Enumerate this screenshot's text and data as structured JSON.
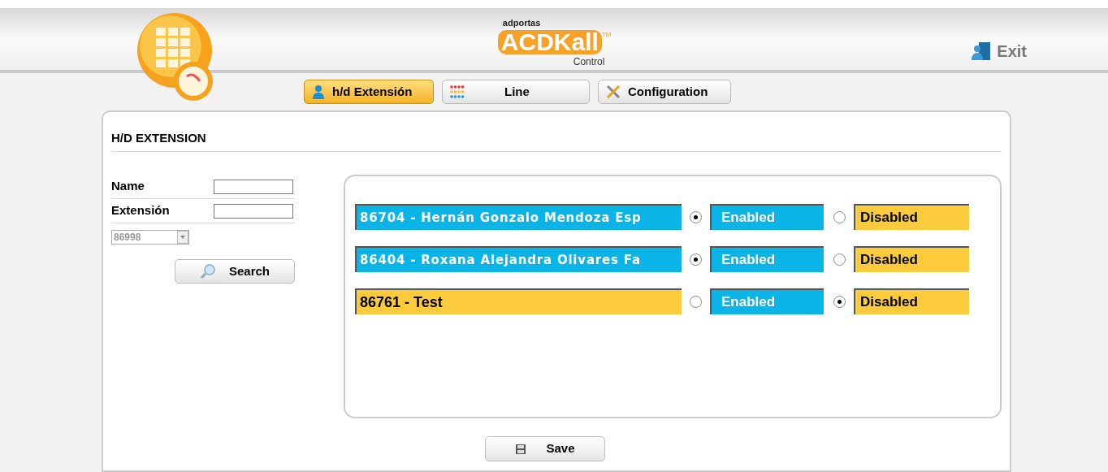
{
  "logo": {
    "brand": "adportas",
    "product": "ACDKall",
    "trademark": "TM",
    "subtitle": "Control"
  },
  "exit": {
    "label": "Exit"
  },
  "tabs": [
    {
      "label": "h/d Extensión",
      "kind": "person",
      "selected": true
    },
    {
      "label": "Line",
      "kind": "dots",
      "selected": false
    },
    {
      "label": "Configuration",
      "kind": "tools",
      "selected": false
    }
  ],
  "panel": {
    "title": "H/D EXTENSION"
  },
  "filters": [
    {
      "label": "Name"
    },
    {
      "label": "Extensión"
    }
  ],
  "select": {
    "value": "86998"
  },
  "search_button": "Search",
  "rows": [
    {
      "name": "86704 - Hernán Gonzalo Mendoza Esp",
      "enabled": true,
      "enabled_label": "Enabled",
      "disabled_label": "Disabled"
    },
    {
      "name": "86404 - Roxana Alejandra Olivares Fa",
      "enabled": true,
      "enabled_label": "Enabled",
      "disabled_label": "Disabled"
    },
    {
      "name": "86761 - Test",
      "enabled": false,
      "enabled_label": "Enabled",
      "disabled_label": "Disabled"
    }
  ],
  "save_button": "Save"
}
